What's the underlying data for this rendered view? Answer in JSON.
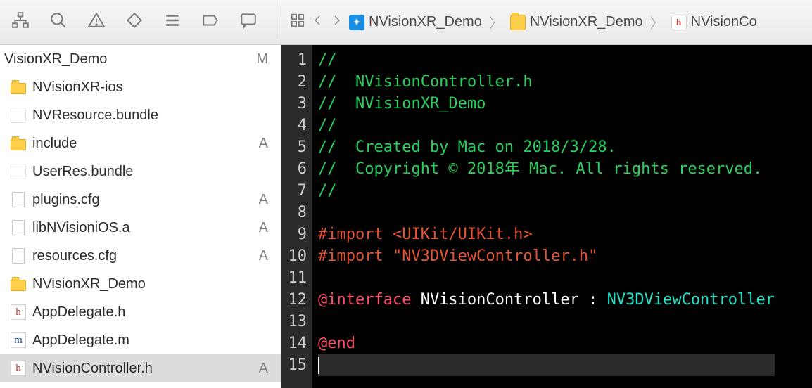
{
  "breadcrumb": {
    "project": "NVisionXR_Demo",
    "folder": "NVisionXR_Demo",
    "file": "NVisionCo"
  },
  "sidebar": {
    "root": {
      "name": "VisionXR_Demo",
      "badge": "M"
    },
    "items": [
      {
        "name": "NVisionXR-ios",
        "type": "folder",
        "badge": ""
      },
      {
        "name": "NVResource.bundle",
        "type": "bundle",
        "badge": ""
      },
      {
        "name": "include",
        "type": "folder",
        "badge": "A"
      },
      {
        "name": "UserRes.bundle",
        "type": "bundle",
        "badge": ""
      },
      {
        "name": "plugins.cfg",
        "type": "file",
        "badge": "A"
      },
      {
        "name": "libNVisioniOS.a",
        "type": "file",
        "badge": "A"
      },
      {
        "name": "resources.cfg",
        "type": "file",
        "badge": "A"
      },
      {
        "name": "NVisionXR_Demo",
        "type": "folder",
        "badge": ""
      },
      {
        "name": "AppDelegate.h",
        "type": "h",
        "badge": ""
      },
      {
        "name": "AppDelegate.m",
        "type": "m",
        "badge": ""
      },
      {
        "name": "NVisionController.h",
        "type": "h",
        "badge": "A",
        "selected": true
      }
    ]
  },
  "code": {
    "lines": [
      {
        "n": 1,
        "segs": [
          {
            "t": "//",
            "c": "c-green"
          }
        ]
      },
      {
        "n": 2,
        "segs": [
          {
            "t": "//  NVisionController.h",
            "c": "c-green"
          }
        ]
      },
      {
        "n": 3,
        "segs": [
          {
            "t": "//  NVisionXR_Demo",
            "c": "c-green"
          }
        ]
      },
      {
        "n": 4,
        "segs": [
          {
            "t": "//",
            "c": "c-green"
          }
        ]
      },
      {
        "n": 5,
        "segs": [
          {
            "t": "//  Created by Mac on 2018/3/28.",
            "c": "c-green"
          }
        ]
      },
      {
        "n": 6,
        "segs": [
          {
            "t": "//  Copyright © 2018年 Mac. All rights reserved.",
            "c": "c-green"
          }
        ]
      },
      {
        "n": 7,
        "segs": [
          {
            "t": "//",
            "c": "c-green"
          }
        ]
      },
      {
        "n": 8,
        "segs": [
          {
            "t": "",
            "c": "c-white"
          }
        ]
      },
      {
        "n": 9,
        "segs": [
          {
            "t": "#import ",
            "c": "c-orange"
          },
          {
            "t": "<UIKit/UIKit.h>",
            "c": "c-red"
          }
        ]
      },
      {
        "n": 10,
        "segs": [
          {
            "t": "#import ",
            "c": "c-orange"
          },
          {
            "t": "\"NV3DViewController.h\"",
            "c": "c-red"
          }
        ]
      },
      {
        "n": 11,
        "segs": [
          {
            "t": "",
            "c": "c-white"
          }
        ]
      },
      {
        "n": 12,
        "segs": [
          {
            "t": "@interface",
            "c": "c-pink"
          },
          {
            "t": " NVisionController : ",
            "c": "c-white"
          },
          {
            "t": "NV3DViewController",
            "c": "c-cyan"
          }
        ]
      },
      {
        "n": 13,
        "segs": [
          {
            "t": "",
            "c": "c-white"
          }
        ]
      },
      {
        "n": 14,
        "segs": [
          {
            "t": "@end",
            "c": "c-pink"
          }
        ]
      },
      {
        "n": 15,
        "segs": [],
        "active": true
      }
    ]
  }
}
